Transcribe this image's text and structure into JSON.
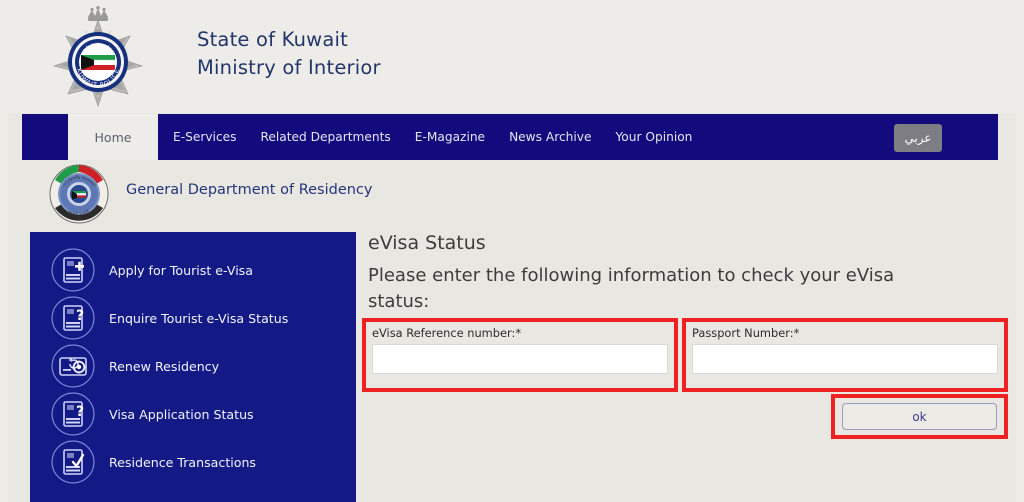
{
  "header": {
    "crest_icon": "kuwait-police-crest",
    "title_line1": "State of Kuwait",
    "title_line2": "Ministry of Interior"
  },
  "nav": {
    "home_label": "Home",
    "links": [
      {
        "label": "E-Services"
      },
      {
        "label": "Related Departments"
      },
      {
        "label": "E-Magazine"
      },
      {
        "label": "News Archive"
      },
      {
        "label": "Your Opinion"
      }
    ],
    "language_button": "عربي"
  },
  "department": {
    "logo_icon": "residency-department-seal",
    "name": "General Department of Residency"
  },
  "sidebar": {
    "items": [
      {
        "label": "Apply for Tourist e-Visa",
        "icon": "document-plus-icon"
      },
      {
        "label": "Enquire Tourist e-Visa Status",
        "icon": "document-question-icon"
      },
      {
        "label": "Renew Residency",
        "icon": "card-renew-icon"
      },
      {
        "label": "Visa Application Status",
        "icon": "document-question-icon"
      },
      {
        "label": "Residence Transactions",
        "icon": "document-check-icon"
      }
    ]
  },
  "main": {
    "title": "eVisa Status",
    "subtitle": "Please enter the following information to check your eVisa status:"
  },
  "form": {
    "reference": {
      "label": "eVisa Reference number:*",
      "value": "",
      "placeholder": ""
    },
    "passport": {
      "label": "Passport Number:*",
      "value": "",
      "placeholder": ""
    },
    "submit_label": "ok"
  },
  "colors": {
    "nav_blue": "#130a7e",
    "sidebar_blue": "#131a85",
    "page_bg": "#e9e7e1",
    "highlight_red": "#ee2222",
    "title_blue": "#23366b"
  }
}
